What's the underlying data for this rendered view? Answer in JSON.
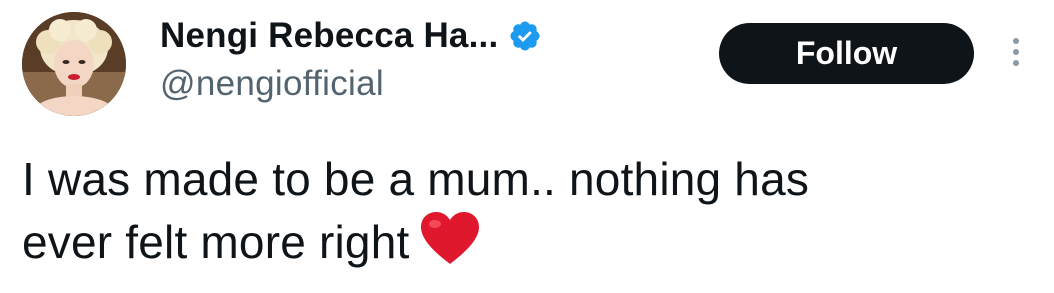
{
  "tweet": {
    "display_name": "Nengi Rebecca Ha...",
    "handle": "@nengiofficial",
    "follow_label": "Follow",
    "text_line1": "I was made to be a mum.. nothing has",
    "text_line2": "ever felt more right",
    "verified_icon": "verified-badge-icon",
    "heart_icon": "red-heart-emoji-icon",
    "more_icon": "more-options-icon"
  },
  "colors": {
    "text": "#0f1419",
    "handle": "#536471",
    "verified": "#1d9bf0",
    "follow_bg": "#0f1419",
    "follow_text": "#ffffff",
    "heart": "#e0182d"
  }
}
